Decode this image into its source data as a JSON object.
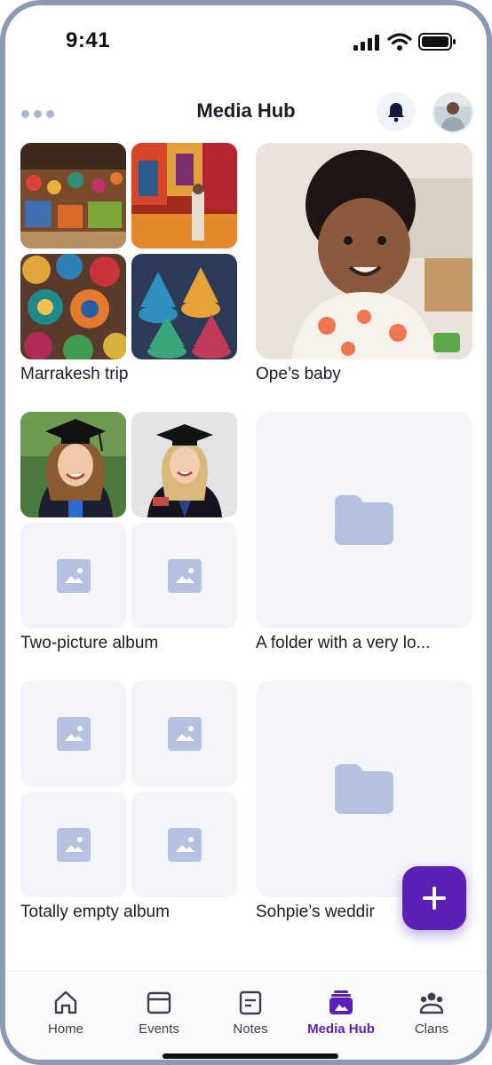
{
  "status": {
    "time": "9:41"
  },
  "header": {
    "title": "Media Hub",
    "more_icon": "more-horizontal-icon",
    "bell_icon": "bell-icon"
  },
  "albums": [
    {
      "label": "Marrakesh trip",
      "kind": "photo-grid",
      "photos": [
        "market-stall",
        "textile-shop",
        "ceramic-plates",
        "tagine-pots"
      ]
    },
    {
      "label": "Ope’s baby",
      "kind": "single-photo"
    },
    {
      "label": "Two-picture album",
      "kind": "photo-grid",
      "photos": [
        "graduate-1",
        "graduate-2",
        "placeholder",
        "placeholder"
      ]
    },
    {
      "label": "A folder with a very lo...",
      "kind": "folder"
    },
    {
      "label": "Totally empty album",
      "kind": "empty-grid"
    },
    {
      "label": "Sohpie’s weddir",
      "kind": "folder"
    }
  ],
  "fab": {
    "icon": "plus-icon"
  },
  "tabs": [
    {
      "label": "Home",
      "icon": "home-icon",
      "active": false
    },
    {
      "label": "Events",
      "icon": "calendar-icon",
      "active": false
    },
    {
      "label": "Notes",
      "icon": "note-icon",
      "active": false
    },
    {
      "label": "Media Hub",
      "icon": "media-hub-icon",
      "active": true
    },
    {
      "label": "Clans",
      "icon": "group-icon",
      "active": false
    }
  ],
  "colors": {
    "accent": "#5b21b6",
    "placeholder_bg": "#f4f5fb",
    "placeholder_icon": "#b6c1e2"
  }
}
